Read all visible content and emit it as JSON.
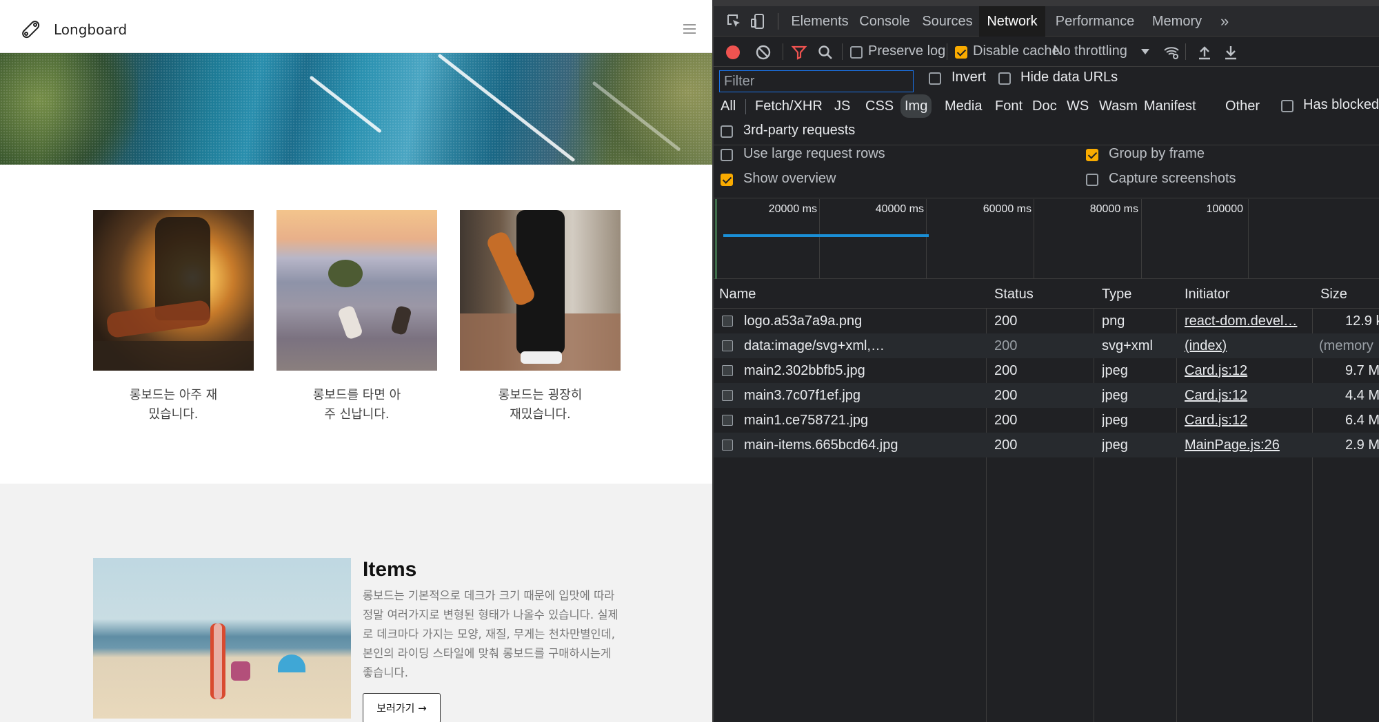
{
  "site": {
    "brand": "Longboard",
    "cards": [
      {
        "caption": "롱보드는 아주 재밌습니다."
      },
      {
        "caption": "롱보드를 타면 아주 신납니다."
      },
      {
        "caption": "롱보드는 굉장히 재밌습니다."
      }
    ],
    "items": {
      "title": "Items",
      "text": "롱보드는 기본적으로 데크가 크기 때문에 입맛에 따라 정말 여러가지로 변형된 형태가 나올수 있습니다. 실제로 데크마다 가지는 모양, 재질, 무게는 천차만별인데, 본인의 라이딩 스타일에 맞춰 롱보드를 구매하시는게 좋습니다.",
      "button": "보러가기 →"
    }
  },
  "devtools": {
    "tabs": [
      "Elements",
      "Console",
      "Sources",
      "Network",
      "Performance",
      "Memory"
    ],
    "active_tab": "Network",
    "more_tabs": "»",
    "toolbar": {
      "preserve_log": {
        "label": "Preserve log",
        "checked": false
      },
      "disable_cache": {
        "label": "Disable cache",
        "checked": true
      },
      "throttling": "No throttling"
    },
    "filter": {
      "placeholder": "Filter",
      "invert": {
        "label": "Invert",
        "checked": false
      },
      "hide_data_urls": {
        "label": "Hide data URLs",
        "checked": false
      }
    },
    "types": [
      "All",
      "Fetch/XHR",
      "JS",
      "CSS",
      "Img",
      "Media",
      "Font",
      "Doc",
      "WS",
      "Wasm",
      "Manifest",
      "Other"
    ],
    "active_type": "Img",
    "has_blocked": {
      "label": "Has blocked",
      "checked": false
    },
    "third_party": {
      "label": "3rd-party requests",
      "checked": false
    },
    "options": {
      "large_rows": {
        "label": "Use large request rows",
        "checked": false
      },
      "group_by_frame": {
        "label": "Group by frame",
        "checked": true
      },
      "show_overview": {
        "label": "Show overview",
        "checked": true
      },
      "capture_screenshots": {
        "label": "Capture screenshots",
        "checked": false
      }
    },
    "overview": {
      "ticks": [
        "20000 ms",
        "40000 ms",
        "60000 ms",
        "80000 ms",
        "100000"
      ]
    },
    "table": {
      "headers": [
        "Name",
        "Status",
        "Type",
        "Initiator",
        "Size"
      ],
      "rows": [
        {
          "name": "logo.a53a7a9a.png",
          "status": "200",
          "type": "png",
          "initiator": "react-dom.devel…",
          "size": "12.9 k"
        },
        {
          "name": "data:image/svg+xml,…",
          "status": "200",
          "type": "svg+xml",
          "initiator": "(index)",
          "size": "(memory"
        },
        {
          "name": "main2.302bbfb5.jpg",
          "status": "200",
          "type": "jpeg",
          "initiator": "Card.js:12",
          "size": "9.7 M"
        },
        {
          "name": "main3.7c07f1ef.jpg",
          "status": "200",
          "type": "jpeg",
          "initiator": "Card.js:12",
          "size": "4.4 M"
        },
        {
          "name": "main1.ce758721.jpg",
          "status": "200",
          "type": "jpeg",
          "initiator": "Card.js:12",
          "size": "6.4 M"
        },
        {
          "name": "main-items.665bcd64.jpg",
          "status": "200",
          "type": "jpeg",
          "initiator": "MainPage.js:26",
          "size": "2.9 M"
        }
      ]
    }
  }
}
